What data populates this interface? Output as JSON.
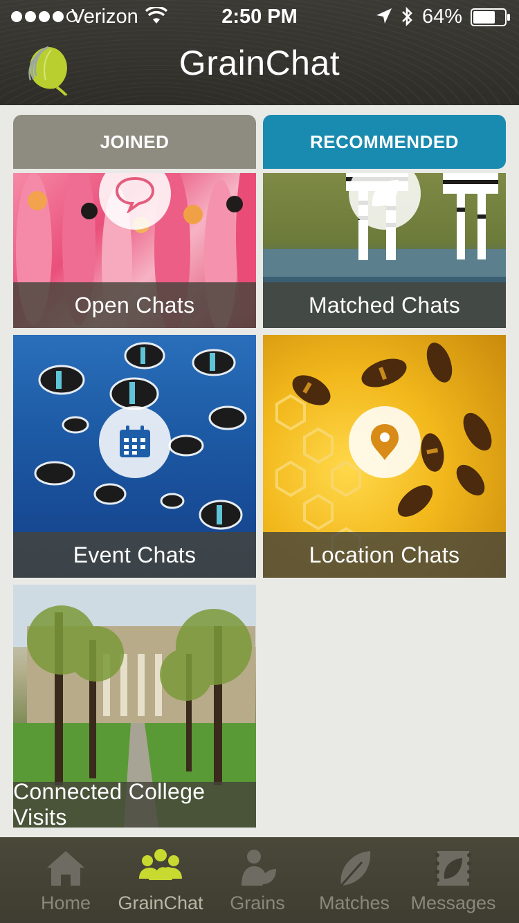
{
  "status_bar": {
    "carrier": "Verizon",
    "time": "2:50 PM",
    "battery": "64%",
    "battery_level": 0.64
  },
  "header": {
    "title": "GrainChat",
    "logo_icon": "leaf-logo-icon"
  },
  "tabs": {
    "joined_label": "JOINED",
    "recommended_label": "RECOMMENDED",
    "active": "recommended"
  },
  "tiles": [
    {
      "label": "Open Chats",
      "icon": "speech-bubble-icon"
    },
    {
      "label": "Matched Chats",
      "icon": "leaf-icon"
    },
    {
      "label": "Event Chats",
      "icon": "calendar-icon"
    },
    {
      "label": "Location Chats",
      "icon": "map-pin-icon"
    },
    {
      "label": "Connected College Visits",
      "icon": ""
    }
  ],
  "nav": {
    "items": [
      {
        "label": "Home",
        "icon": "home-icon"
      },
      {
        "label": "GrainChat",
        "icon": "people-icon"
      },
      {
        "label": "Grains",
        "icon": "person-leaf-icon"
      },
      {
        "label": "Matches",
        "icon": "leaf-icon"
      },
      {
        "label": "Messages",
        "icon": "stamp-icon"
      }
    ],
    "active": "GrainChat"
  },
  "colors": {
    "accent_blue": "#1a8bb0",
    "tab_gray": "#8e8c80",
    "active_nav": "#c8d930",
    "inactive_nav": "#6e6c62"
  }
}
